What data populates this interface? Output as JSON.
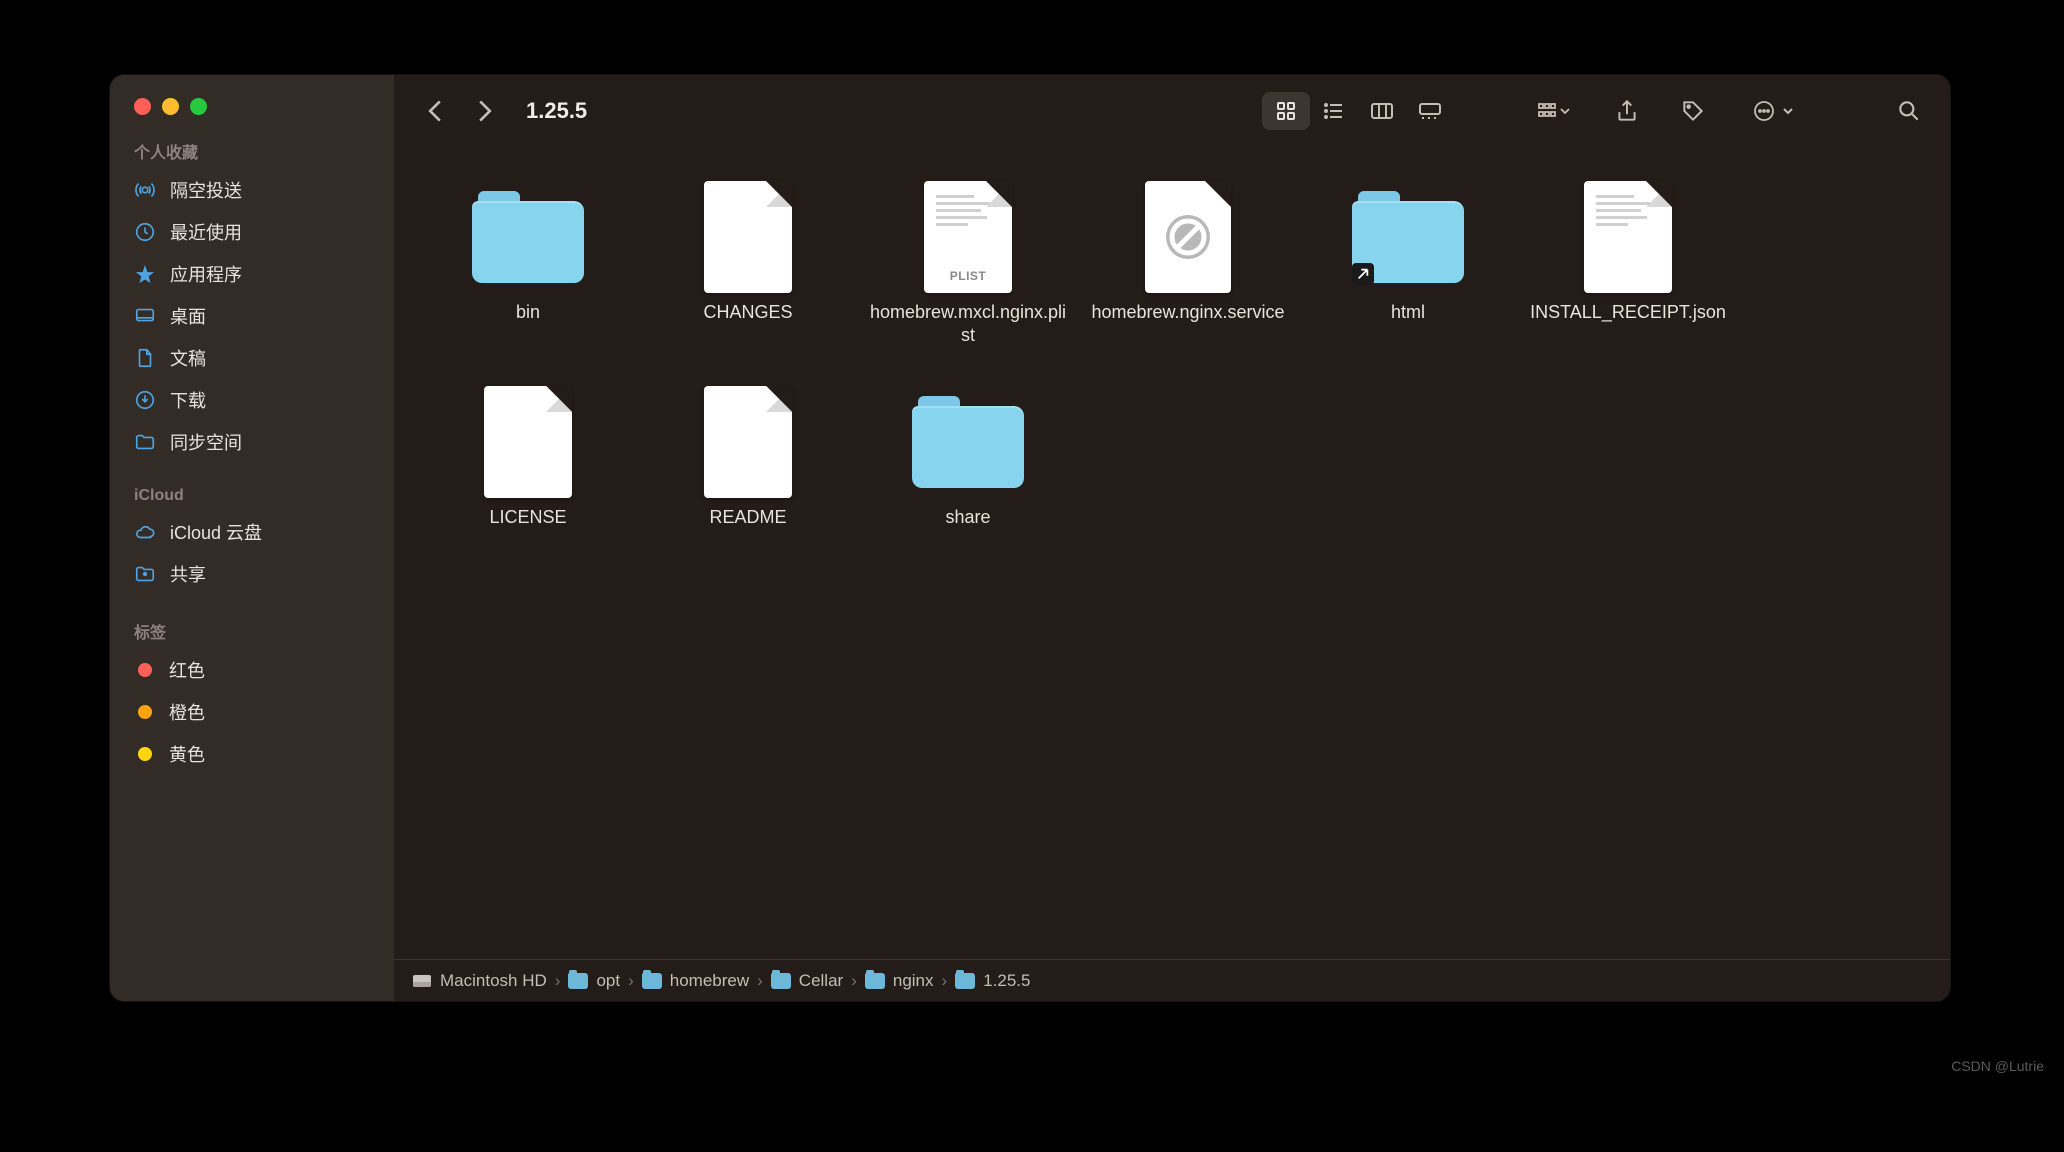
{
  "window_title": "1.25.5",
  "sidebar": {
    "favorites_header": "个人收藏",
    "icloud_header": "iCloud",
    "tags_header": "标签",
    "favorites": [
      {
        "label": "隔空投送",
        "icon": "airdrop"
      },
      {
        "label": "最近使用",
        "icon": "clock"
      },
      {
        "label": "应用程序",
        "icon": "apps"
      },
      {
        "label": "桌面",
        "icon": "desktop"
      },
      {
        "label": "文稿",
        "icon": "doc"
      },
      {
        "label": "下载",
        "icon": "download"
      },
      {
        "label": "同步空间",
        "icon": "folder"
      }
    ],
    "icloud": [
      {
        "label": "iCloud 云盘",
        "icon": "cloud"
      },
      {
        "label": "共享",
        "icon": "shared"
      }
    ],
    "tags": [
      {
        "label": "红色",
        "color": "#ff6159"
      },
      {
        "label": "橙色",
        "color": "#ffa40e"
      },
      {
        "label": "黄色",
        "color": "#ffd50d"
      }
    ]
  },
  "items": [
    {
      "name": "bin",
      "type": "folder"
    },
    {
      "name": "CHANGES",
      "type": "file"
    },
    {
      "name": "homebrew.mxcl.nginx.plist",
      "type": "plist",
      "badge": "PLIST"
    },
    {
      "name": "homebrew.nginx.service",
      "type": "blocked"
    },
    {
      "name": "html",
      "type": "folder-alias"
    },
    {
      "name": "INSTALL_RECEIPT.json",
      "type": "text"
    },
    {
      "name": "LICENSE",
      "type": "file"
    },
    {
      "name": "README",
      "type": "file"
    },
    {
      "name": "share",
      "type": "folder"
    }
  ],
  "path": [
    {
      "label": "Macintosh HD",
      "icon": "hd"
    },
    {
      "label": "opt",
      "icon": "folder"
    },
    {
      "label": "homebrew",
      "icon": "folder"
    },
    {
      "label": "Cellar",
      "icon": "folder"
    },
    {
      "label": "nginx",
      "icon": "folder"
    },
    {
      "label": "1.25.5",
      "icon": "folder"
    }
  ],
  "watermark": "CSDN @Lutrie"
}
